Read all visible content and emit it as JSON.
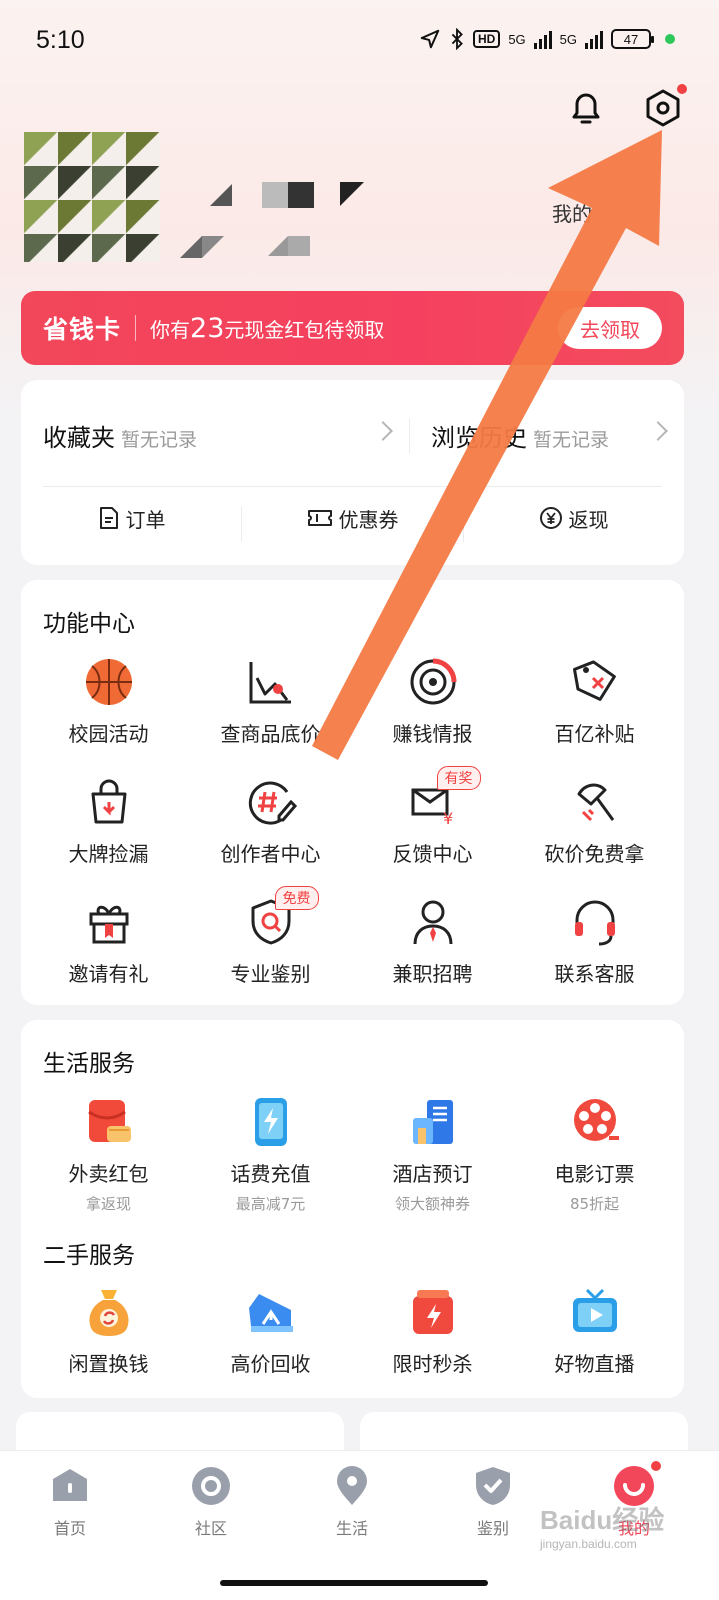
{
  "status_bar": {
    "time": "5:10",
    "network1": "5G",
    "network2": "5G",
    "hd": "HD",
    "battery": "47"
  },
  "header": {
    "bell_icon": "bell-icon",
    "settings_icon": "settings-hexagon-icon",
    "my_link": "我的"
  },
  "promo": {
    "title": "省钱卡",
    "text_prefix": "你有",
    "amount": "23",
    "text_suffix": "元现金红包待领取",
    "button": "去领取"
  },
  "favorites": {
    "left_title": "收藏夹",
    "left_sub": "暂无记录",
    "right_title": "浏览历史",
    "right_sub": "暂无记录",
    "actions": [
      {
        "label": "订单"
      },
      {
        "label": "优惠券"
      },
      {
        "label": "返现"
      }
    ]
  },
  "function_center": {
    "title": "功能中心",
    "items": [
      {
        "label": "校园活动",
        "icon": "basketball-icon"
      },
      {
        "label": "查商品底价",
        "icon": "chart-icon"
      },
      {
        "label": "赚钱情报",
        "icon": "target-icon"
      },
      {
        "label": "百亿补贴",
        "icon": "tag-icon"
      },
      {
        "label": "大牌捡漏",
        "icon": "bag-icon"
      },
      {
        "label": "创作者中心",
        "icon": "hashtag-pen-icon"
      },
      {
        "label": "反馈中心",
        "icon": "feedback-icon",
        "badge": "有奖"
      },
      {
        "label": "砍价免费拿",
        "icon": "axe-icon"
      },
      {
        "label": "邀请有礼",
        "icon": "gift-icon"
      },
      {
        "label": "专业鉴别",
        "icon": "shield-search-icon",
        "badge": "免费"
      },
      {
        "label": "兼职招聘",
        "icon": "person-icon"
      },
      {
        "label": "联系客服",
        "icon": "headset-icon"
      }
    ]
  },
  "life_services": {
    "title": "生活服务",
    "items": [
      {
        "label": "外卖红包",
        "sub": "拿返现",
        "icon": "takeout-icon"
      },
      {
        "label": "话费充值",
        "sub": "最高减7元",
        "icon": "phone-charge-icon"
      },
      {
        "label": "酒店预订",
        "sub": "领大额神券",
        "icon": "hotel-icon"
      },
      {
        "label": "电影订票",
        "sub": "85折起",
        "icon": "film-icon"
      }
    ]
  },
  "secondhand": {
    "title": "二手服务",
    "items": [
      {
        "label": "闲置换钱",
        "icon": "money-bag-icon"
      },
      {
        "label": "高价回收",
        "icon": "sneaker-icon"
      },
      {
        "label": "限时秒杀",
        "icon": "flash-sale-icon"
      },
      {
        "label": "好物直播",
        "icon": "tv-icon"
      }
    ]
  },
  "tab_bar": {
    "tabs": [
      {
        "label": "首页",
        "icon": "home-icon"
      },
      {
        "label": "社区",
        "icon": "community-icon"
      },
      {
        "label": "生活",
        "icon": "location-icon"
      },
      {
        "label": "鉴别",
        "icon": "shield-check-icon"
      },
      {
        "label": "我的",
        "icon": "smile-icon",
        "active": true
      }
    ]
  },
  "colors": {
    "accent": "#f2465a",
    "arrow": "#f47a45"
  },
  "watermark": {
    "title": "Baidu经验",
    "url": "jingyan.baidu.com"
  }
}
